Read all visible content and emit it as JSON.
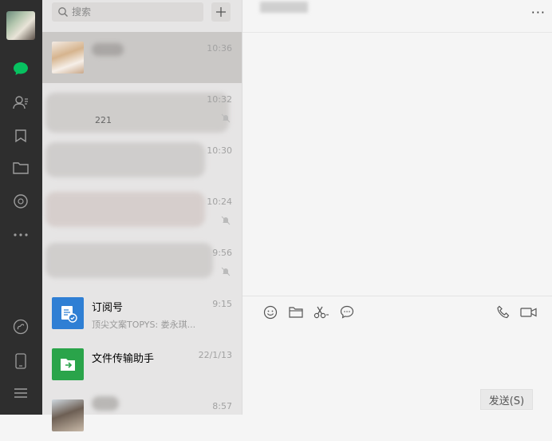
{
  "search": {
    "placeholder": "搜索"
  },
  "chats": [
    {
      "time": "10:36"
    },
    {
      "time": "10:32",
      "preview": "221"
    },
    {
      "time": "10:30"
    },
    {
      "time": "10:24"
    },
    {
      "time": "9:56"
    },
    {
      "name": "订阅号",
      "time": "9:15",
      "preview": "顶尖文案TOPYS: 娄永琪..."
    },
    {
      "name": "文件传输助手",
      "time": "22/1/13"
    },
    {
      "time": "8:57"
    }
  ],
  "compose": {
    "send_label": "发送(S)"
  },
  "chat": {
    "more_label": "···"
  },
  "icons": {
    "chat": "chat-bubble-icon",
    "contacts": "contacts-icon",
    "favorites": "favorites-icon",
    "files": "folder-icon",
    "moments": "moments-icon",
    "more": "more-icon",
    "mini_programs": "mini-program-icon",
    "phone": "phone-icon",
    "menu": "menu-icon",
    "emoji": "emoji-icon",
    "folder": "folder-icon",
    "scissors": "scissors-icon",
    "bubble": "speech-bubble-icon",
    "call": "phone-call-icon",
    "video": "video-call-icon"
  },
  "colors": {
    "accent": "#07c160",
    "rail": "#2e2e2e",
    "selected": "#cac8c6",
    "subscription": "#2f7fd4",
    "file_helper": "#2aa44a"
  }
}
